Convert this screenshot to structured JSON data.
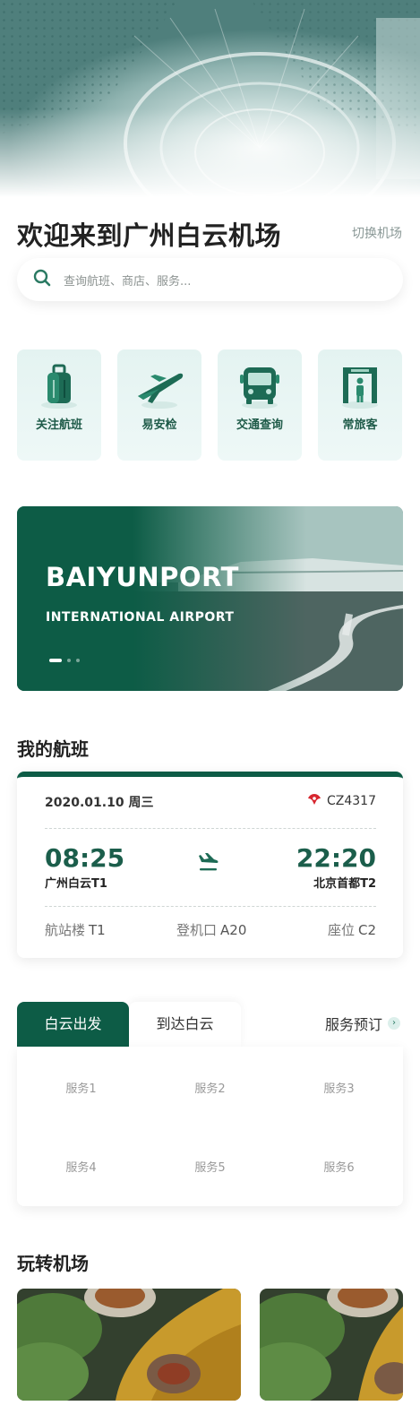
{
  "header": {
    "welcome": "欢迎来到广州白云机场",
    "switch_airport": "切换机场"
  },
  "search": {
    "placeholder": "查询航班、商店、服务..."
  },
  "quick_links": [
    {
      "label": "关注航班",
      "icon": "luggage-icon"
    },
    {
      "label": "易安检",
      "icon": "plane-takeoff-icon"
    },
    {
      "label": "交通查询",
      "icon": "bus-icon"
    },
    {
      "label": "常旅客",
      "icon": "gate-icon"
    }
  ],
  "banner": {
    "title": "BAIYUNPORT",
    "subtitle": "INTERNATIONAL AIRPORT",
    "slides": 3,
    "active_slide": 1
  },
  "my_flight": {
    "section_title": "我的航班",
    "date": "2020.01.10 周三",
    "flight_no": "CZ4317",
    "dep_time": "08:25",
    "dep_city": "广州白云T1",
    "arr_time": "22:20",
    "arr_city": "北京首都T2",
    "terminal_label": "航站楼",
    "terminal": "T1",
    "gate_label": "登机口",
    "gate": "A20",
    "seat_label": "座位",
    "seat": "C2"
  },
  "services_tabs": {
    "tabs": [
      "白云出发",
      "到达白云"
    ],
    "active_tab": 0,
    "booking_link": "服务预订",
    "items": [
      "服务1",
      "服务2",
      "服务3",
      "服务4",
      "服务5",
      "服务6"
    ]
  },
  "explore": {
    "section_title": "玩转机场"
  },
  "colors": {
    "brand": "#0d5c46",
    "accent_text": "#1b5e4b",
    "quick_bg": "#e4f3f1"
  }
}
